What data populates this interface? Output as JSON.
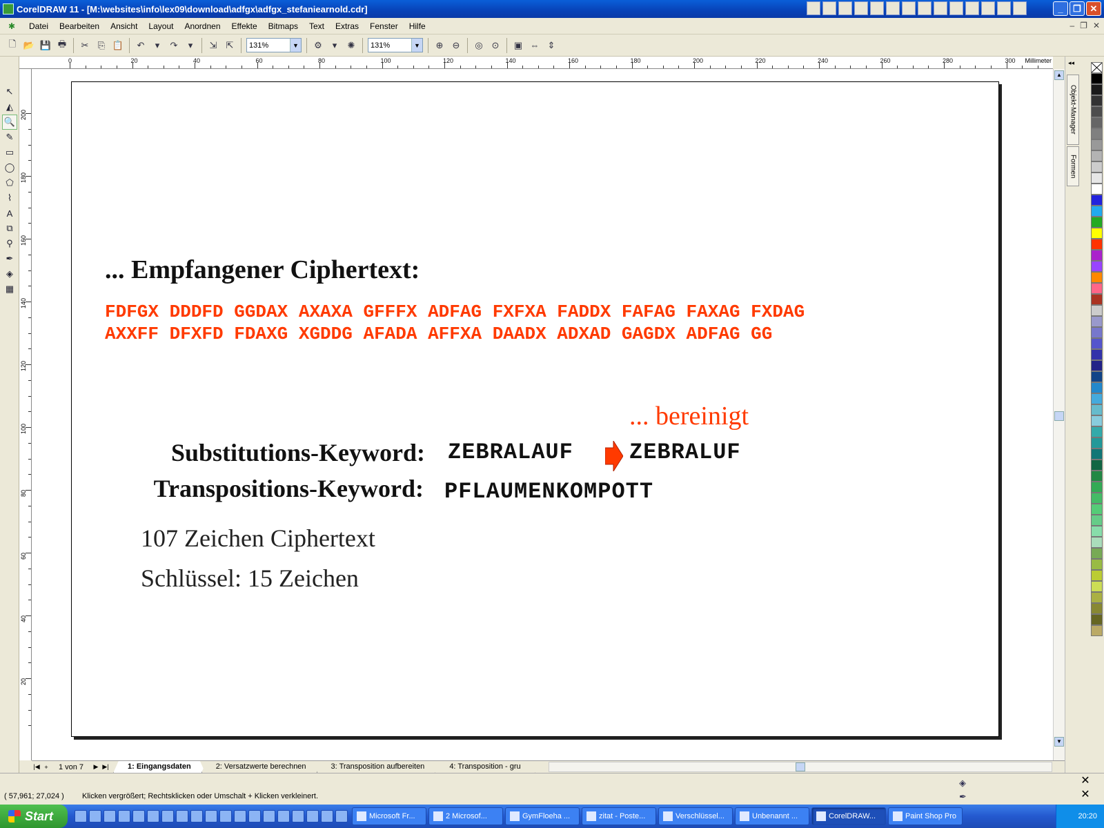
{
  "window": {
    "title": "CorelDRAW 11 - [M:\\websites\\info\\lex09\\download\\adfgx\\adfgx_stefaniearnold.cdr]"
  },
  "menu": [
    "Datei",
    "Bearbeiten",
    "Ansicht",
    "Layout",
    "Anordnen",
    "Effekte",
    "Bitmaps",
    "Text",
    "Extras",
    "Fenster",
    "Hilfe"
  ],
  "toolbar": {
    "zoom_left": "131%",
    "zoom_right": "131%"
  },
  "ruler": {
    "h_labels": [
      "0",
      "20",
      "40",
      "60",
      "80",
      "100",
      "120",
      "140",
      "160",
      "180",
      "200",
      "220",
      "240",
      "260",
      "280",
      "300"
    ],
    "h_unit": "Millimeter",
    "v_labels": [
      "200",
      "180",
      "160",
      "140",
      "120",
      "100",
      "80",
      "60",
      "40",
      "20"
    ],
    "v_unit": "Millimeter"
  },
  "document": {
    "heading": "... Empfangener Ciphertext:",
    "cipher_line1": "FDFGX DDDFD GGDAX AXAXA GFFFX ADFAG FXFXA FADDX FAFAG FAXAG FXDAG",
    "cipher_line2": "AXXFF DFXFD FDAXG XGDDG AFADA AFFXA DAADX ADXAD GAGDX ADFAG GG",
    "cleaned_note": "... bereinigt",
    "subst_label": "Substitutions-Keyword:",
    "subst_value": "ZEBRALAUF",
    "subst_cleaned": "ZEBRALUF",
    "transp_label": "Transpositions-Keyword:",
    "transp_value": "PFLAUMENKOMPOTT",
    "info1": "107 Zeichen Ciphertext",
    "info2": "Schlüssel: 15 Zeichen",
    "accent_color": "#ff3a00"
  },
  "dockers": [
    "Objekt-Manager",
    "Formen"
  ],
  "page_tabs": {
    "count": "1 von 7",
    "tabs": [
      "1: Eingangsdaten",
      "2: Versatzwerte berechnen",
      "3: Transposition aufbereiten",
      "4: Transposition - gru"
    ]
  },
  "status": {
    "coords": "( 57,961; 27,024 )",
    "hint": "Klicken vergrößert; Rechtsklicken oder Umschalt + Klicken verkleinert."
  },
  "taskbar": {
    "start": "Start",
    "tasks": [
      "Microsoft Fr...",
      "2 Microsof...",
      "GymFloeha ...",
      "zitat - Poste...",
      "Verschlüssel...",
      "Unbenannt ...",
      "CorelDRAW...",
      "Paint Shop Pro"
    ],
    "time": "20:20"
  },
  "palette_colors": [
    "#000000",
    "#1a1a1a",
    "#333333",
    "#4d4d4d",
    "#666666",
    "#808080",
    "#999999",
    "#b3b3b3",
    "#cccccc",
    "#e6e6e6",
    "#ffffff",
    "#2222dd",
    "#22aaee",
    "#22aa22",
    "#ffff00",
    "#ff3300",
    "#aa22cc",
    "#9944ff",
    "#ff8800",
    "#ff6688",
    "#aa3322",
    "#cccccc",
    "#9999cc",
    "#7777cc",
    "#5555cc",
    "#3333aa",
    "#222288",
    "#114488",
    "#2288cc",
    "#44aadd",
    "#66bbcc",
    "#88ccdd",
    "#33aaaa",
    "#229999",
    "#117777",
    "#116644",
    "#228844",
    "#33aa55",
    "#44bb66",
    "#55cc77",
    "#66cc88",
    "#88ddaa",
    "#aaddbb",
    "#77aa55",
    "#99bb44",
    "#bbcc33",
    "#ccdd55",
    "#aab044",
    "#888833",
    "#666622",
    "#bbaa66"
  ]
}
